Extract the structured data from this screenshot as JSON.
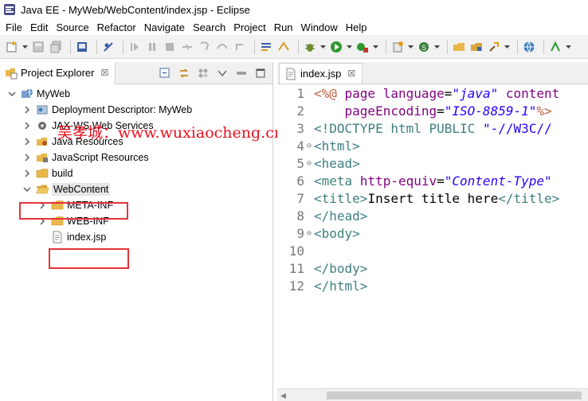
{
  "window": {
    "title": "Java EE - MyWeb/WebContent/index.jsp - Eclipse"
  },
  "menu": [
    "File",
    "Edit",
    "Source",
    "Refactor",
    "Navigate",
    "Search",
    "Project",
    "Run",
    "Window",
    "Help"
  ],
  "explorer": {
    "tab_label": "Project Explorer",
    "close_glyph": "☒",
    "tree": [
      {
        "label": "MyWeb",
        "level": 0,
        "expanded": true,
        "icon": "web-project-icon"
      },
      {
        "label": "Deployment Descriptor: MyWeb",
        "level": 1,
        "expanded": false,
        "icon": "deployment-descriptor-icon"
      },
      {
        "label": "JAX-WS Web Services",
        "level": 1,
        "expanded": false,
        "icon": "web-services-icon"
      },
      {
        "label": "Java Resources",
        "level": 1,
        "expanded": false,
        "icon": "java-resources-icon"
      },
      {
        "label": "JavaScript Resources",
        "level": 1,
        "expanded": false,
        "icon": "javascript-resources-icon"
      },
      {
        "label": "build",
        "level": 1,
        "expanded": false,
        "icon": "folder-icon"
      },
      {
        "label": "WebContent",
        "level": 1,
        "expanded": true,
        "icon": "folder-open-icon",
        "selected": true
      },
      {
        "label": "META-INF",
        "level": 2,
        "expanded": false,
        "icon": "folder-icon"
      },
      {
        "label": "WEB-INF",
        "level": 2,
        "expanded": false,
        "icon": "folder-icon"
      },
      {
        "label": "index.jsp",
        "level": 2,
        "leaf": true,
        "icon": "jsp-file-icon"
      }
    ]
  },
  "watermark": "吴孝城：www.wuxiaocheng.cn",
  "editor": {
    "tab_label": "index.jsp",
    "close_glyph": "☒",
    "lines": [
      {
        "n": "1",
        "fold": "",
        "tokens": [
          [
            "c-dir",
            "<%@ "
          ],
          [
            "c-attr",
            "page "
          ],
          [
            "c-attr",
            "language"
          ],
          [
            "c-txt",
            "="
          ],
          [
            "c-val",
            "\"java\" "
          ],
          [
            "c-attr",
            "content"
          ]
        ]
      },
      {
        "n": "2",
        "fold": "",
        "tokens": [
          [
            "c-txt",
            "    "
          ],
          [
            "c-attr",
            "pageEncoding"
          ],
          [
            "c-txt",
            "="
          ],
          [
            "c-val",
            "\"ISO-8859-1\""
          ],
          [
            "c-dir",
            "%>"
          ]
        ]
      },
      {
        "n": "3",
        "fold": "",
        "tokens": [
          [
            "c-doc",
            "<!DOCTYPE "
          ],
          [
            "c-tag",
            "html "
          ],
          [
            "c-doc",
            "PUBLIC "
          ],
          [
            "c-str",
            "\"-//W3C//"
          ]
        ]
      },
      {
        "n": "4",
        "fold": "⊖",
        "tokens": [
          [
            "c-tag",
            "<html>"
          ]
        ]
      },
      {
        "n": "5",
        "fold": "⊖",
        "tokens": [
          [
            "c-tag",
            "<head>"
          ]
        ]
      },
      {
        "n": "6",
        "fold": "",
        "tokens": [
          [
            "c-tag",
            "<meta "
          ],
          [
            "c-attr",
            "http-equiv"
          ],
          [
            "c-txt",
            "="
          ],
          [
            "c-val",
            "\"Content-Type\""
          ]
        ]
      },
      {
        "n": "7",
        "fold": "",
        "tokens": [
          [
            "c-tag",
            "<title>"
          ],
          [
            "c-txt",
            "Insert title here"
          ],
          [
            "c-tag",
            "</title>"
          ]
        ]
      },
      {
        "n": "8",
        "fold": "",
        "tokens": [
          [
            "c-tag",
            "</head>"
          ]
        ]
      },
      {
        "n": "9",
        "fold": "⊖",
        "tokens": [
          [
            "c-tag",
            "<body>"
          ]
        ]
      },
      {
        "n": "10",
        "fold": "",
        "tokens": []
      },
      {
        "n": "11",
        "fold": "",
        "tokens": [
          [
            "c-tag",
            "</body>"
          ]
        ]
      },
      {
        "n": "12",
        "fold": "",
        "tokens": [
          [
            "c-tag",
            "</html>"
          ]
        ]
      }
    ]
  },
  "colors": {
    "highlight_box": "#e43339",
    "watermark": "#e8101e",
    "selection": "#e6e6e6",
    "folder": "#e8b84a"
  }
}
